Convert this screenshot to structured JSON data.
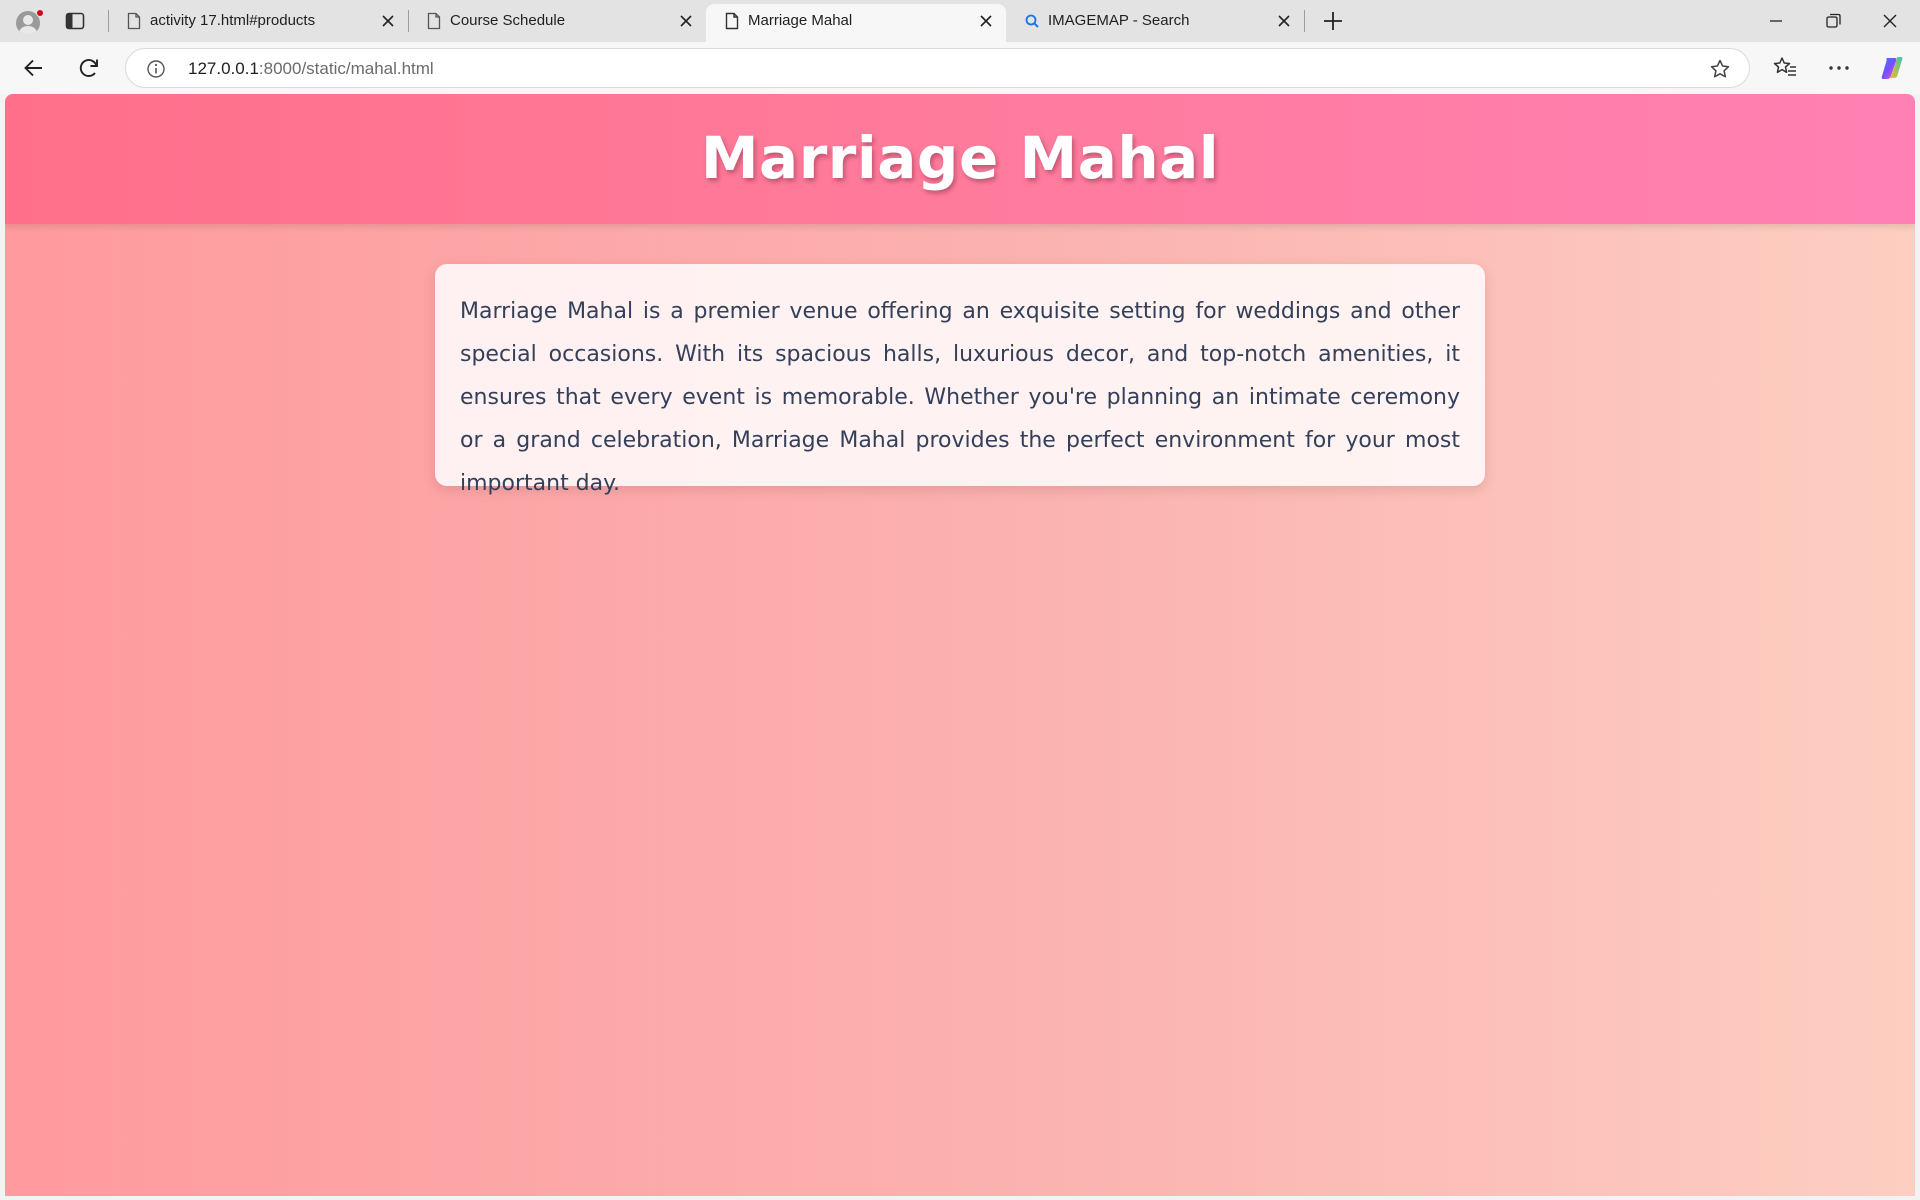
{
  "browser": {
    "tabs": [
      {
        "title": "activity 17.html#products",
        "icon": "page-icon",
        "active": false
      },
      {
        "title": "Course Schedule",
        "icon": "page-icon",
        "active": false
      },
      {
        "title": "Marriage Mahal",
        "icon": "page-icon",
        "active": true
      },
      {
        "title": "IMAGEMAP - Search",
        "icon": "search-icon",
        "active": false
      }
    ],
    "address": {
      "host": "127.0.0.1",
      "path": ":8000/static/mahal.html"
    }
  },
  "page": {
    "title": "Marriage Mahal",
    "description": "Marriage Mahal is a premier venue offering an exquisite setting for weddings and other special occasions. With its spacious halls, luxurious decor, and top-notch amenities, it ensures that every event is memorable. Whether you're planning an intimate ceremony or a grand celebration, Marriage Mahal provides the perfect environment for your most important day.",
    "colors": {
      "header_start": "#ff6f8a",
      "header_end": "#ff80b3",
      "background_start": "#ff9a9e",
      "background_end": "#fdcec1",
      "text": "#34405a"
    }
  }
}
